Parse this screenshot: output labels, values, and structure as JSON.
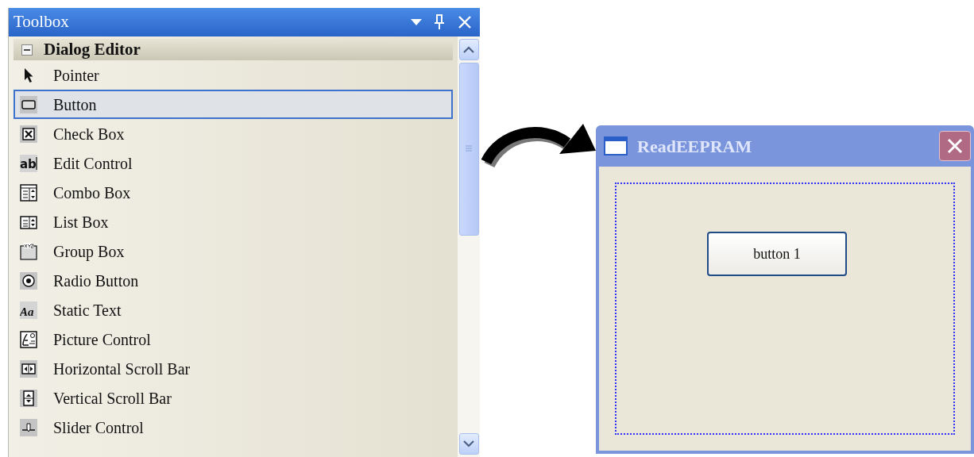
{
  "toolbox": {
    "title": "Toolbox",
    "group": {
      "label": "Dialog Editor",
      "expanded": true
    },
    "items": [
      {
        "kind": "pointer",
        "label": "Pointer",
        "selected": false
      },
      {
        "kind": "button",
        "label": "Button",
        "selected": true
      },
      {
        "kind": "checkbox",
        "label": "Check Box",
        "selected": false
      },
      {
        "kind": "edit",
        "icon_text": "ab",
        "label": "Edit Control",
        "selected": false
      },
      {
        "kind": "combo",
        "label": "Combo Box",
        "selected": false
      },
      {
        "kind": "list",
        "label": "List Box",
        "selected": false
      },
      {
        "kind": "group",
        "label": "Group Box",
        "selected": false
      },
      {
        "kind": "radio",
        "label": "Radio Button",
        "selected": false
      },
      {
        "kind": "static",
        "icon_text": "Aa",
        "label": "Static Text",
        "selected": false
      },
      {
        "kind": "picture",
        "label": "Picture Control",
        "selected": false
      },
      {
        "kind": "hscroll",
        "label": "Horizontal Scroll Bar",
        "selected": false
      },
      {
        "kind": "vscroll",
        "label": "Vertical Scroll Bar",
        "selected": false
      },
      {
        "kind": "slider",
        "label": "Slider Control",
        "selected": false
      }
    ]
  },
  "dialog": {
    "title": "ReadEEPRAM",
    "button": "button 1"
  }
}
